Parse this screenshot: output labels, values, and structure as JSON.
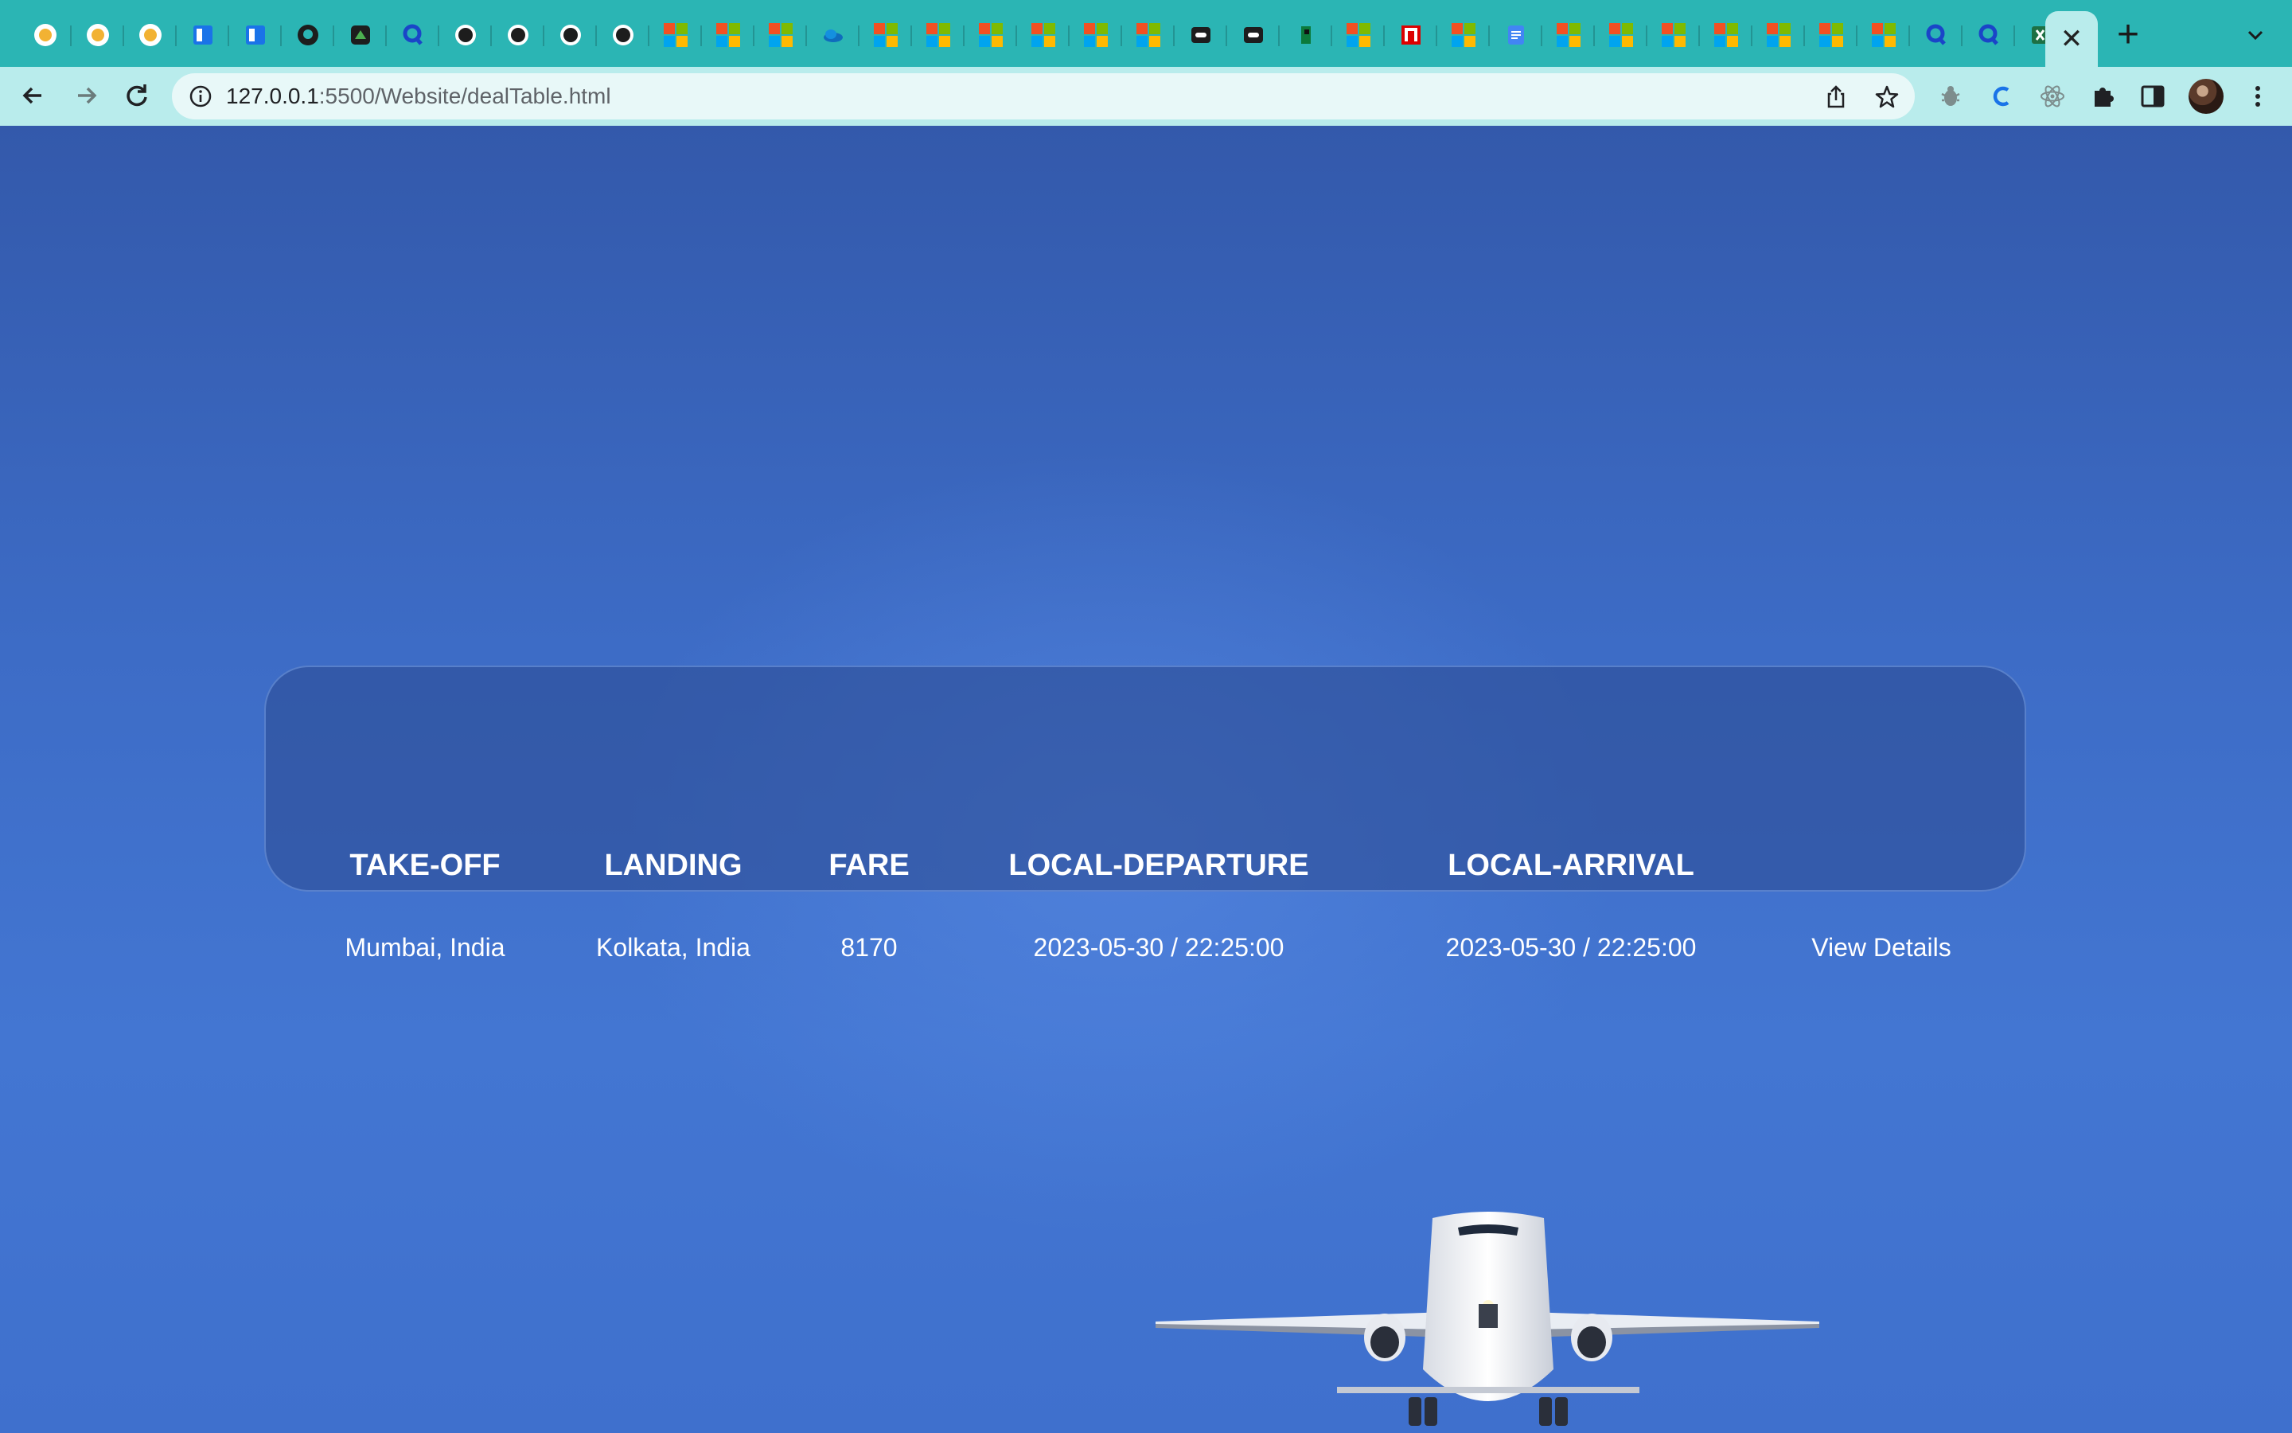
{
  "browser": {
    "url_host": "127.0.0.1",
    "url_path": ":5500/Website/dealTable.html",
    "active_tab_close": "✕",
    "new_tab": "+",
    "icons": [
      "back-arrow-icon",
      "forward-arrow-icon",
      "reload-icon",
      "info-icon",
      "share-icon",
      "star-icon",
      "extension-bug-icon",
      "extension-c-icon",
      "react-devtools-icon",
      "puzzle-icon",
      "side-panel-icon",
      "avatar",
      "kebab-menu-icon"
    ]
  },
  "table": {
    "headers": [
      "TAKE-OFF",
      "LANDING",
      "FARE",
      "LOCAL-DEPARTURE",
      "LOCAL-ARRIVAL"
    ],
    "rows": [
      {
        "takeoff": "Mumbai, India",
        "landing": "Kolkata, India",
        "fare": "8170",
        "departure": "2023-05-30 / 22:25:00",
        "arrival": "2023-05-30 / 22:25:00",
        "action": "View Details"
      }
    ]
  },
  "colors": {
    "tabstrip": "#2bb5b4",
    "toolbar": "#b9ecec",
    "page_background": "#3d6cc6",
    "card_background": "#2d4e96"
  }
}
